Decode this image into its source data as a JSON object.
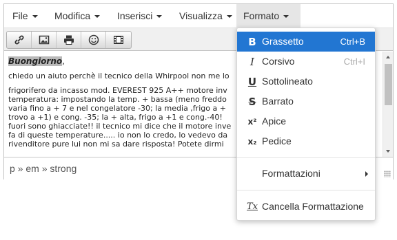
{
  "menubar": {
    "items": [
      {
        "label": "File"
      },
      {
        "label": "Modifica"
      },
      {
        "label": "Inserisci"
      },
      {
        "label": "Visualizza"
      },
      {
        "label": "Formato"
      }
    ]
  },
  "toolbar": {
    "buttons": [
      {
        "icon": "link-icon"
      },
      {
        "icon": "image-icon"
      },
      {
        "icon": "print-icon"
      },
      {
        "icon": "emoticon-icon"
      },
      {
        "icon": "media-icon"
      }
    ]
  },
  "content": {
    "greeting": "Buongiorno",
    "greeting_suffix": ",",
    "line1": "chiedo un aiuto perchè il tecnico della Whirpool non me lo",
    "line2": "frigorifero da incasso mod. EVEREST 925 A++ motore inv",
    "line3": "temperatura: impostando la temp. + bassa (meno freddo",
    "line4": "varia fino a + 7 e nel congelatore -30; la media ,frigo a +",
    "line5": "trovo a +1) e cong. -35; la + alta, frigo a +1 e cong.-40!",
    "line6": "fuori sono ghiacciate!! il tecnico mi dice che il motore inve",
    "line7": "fa di queste temperature..... io non lo credo, lo vedevo da",
    "line8": "rivenditore pure lui non mi sa dare risposta! Potete dirmi"
  },
  "statusbar": {
    "path": "p » em » strong"
  },
  "format_menu": {
    "items": [
      {
        "label": "Grassetto",
        "shortcut": "Ctrl+B",
        "icon": "bold-icon",
        "glyph": "B"
      },
      {
        "label": "Corsivo",
        "shortcut": "Ctrl+I",
        "icon": "italic-icon",
        "glyph": "I"
      },
      {
        "label": "Sottolineato",
        "shortcut": "",
        "icon": "underline-icon",
        "glyph": "U"
      },
      {
        "label": "Barrato",
        "shortcut": "",
        "icon": "strikethrough-icon",
        "glyph": "S"
      },
      {
        "label": "Apice",
        "shortcut": "",
        "icon": "superscript-icon",
        "glyph": "x²"
      },
      {
        "label": "Pedice",
        "shortcut": "",
        "icon": "subscript-icon",
        "glyph": "x₂"
      },
      {
        "label": "Formattazioni",
        "shortcut": "",
        "icon": "",
        "glyph": ""
      },
      {
        "label": "Cancella Formattazione",
        "shortcut": "",
        "icon": "clear-format-icon",
        "glyph": "Tx"
      }
    ]
  },
  "colors": {
    "selected_bg": "#2276d2",
    "menu_active_bg": "#e6e6e6"
  }
}
